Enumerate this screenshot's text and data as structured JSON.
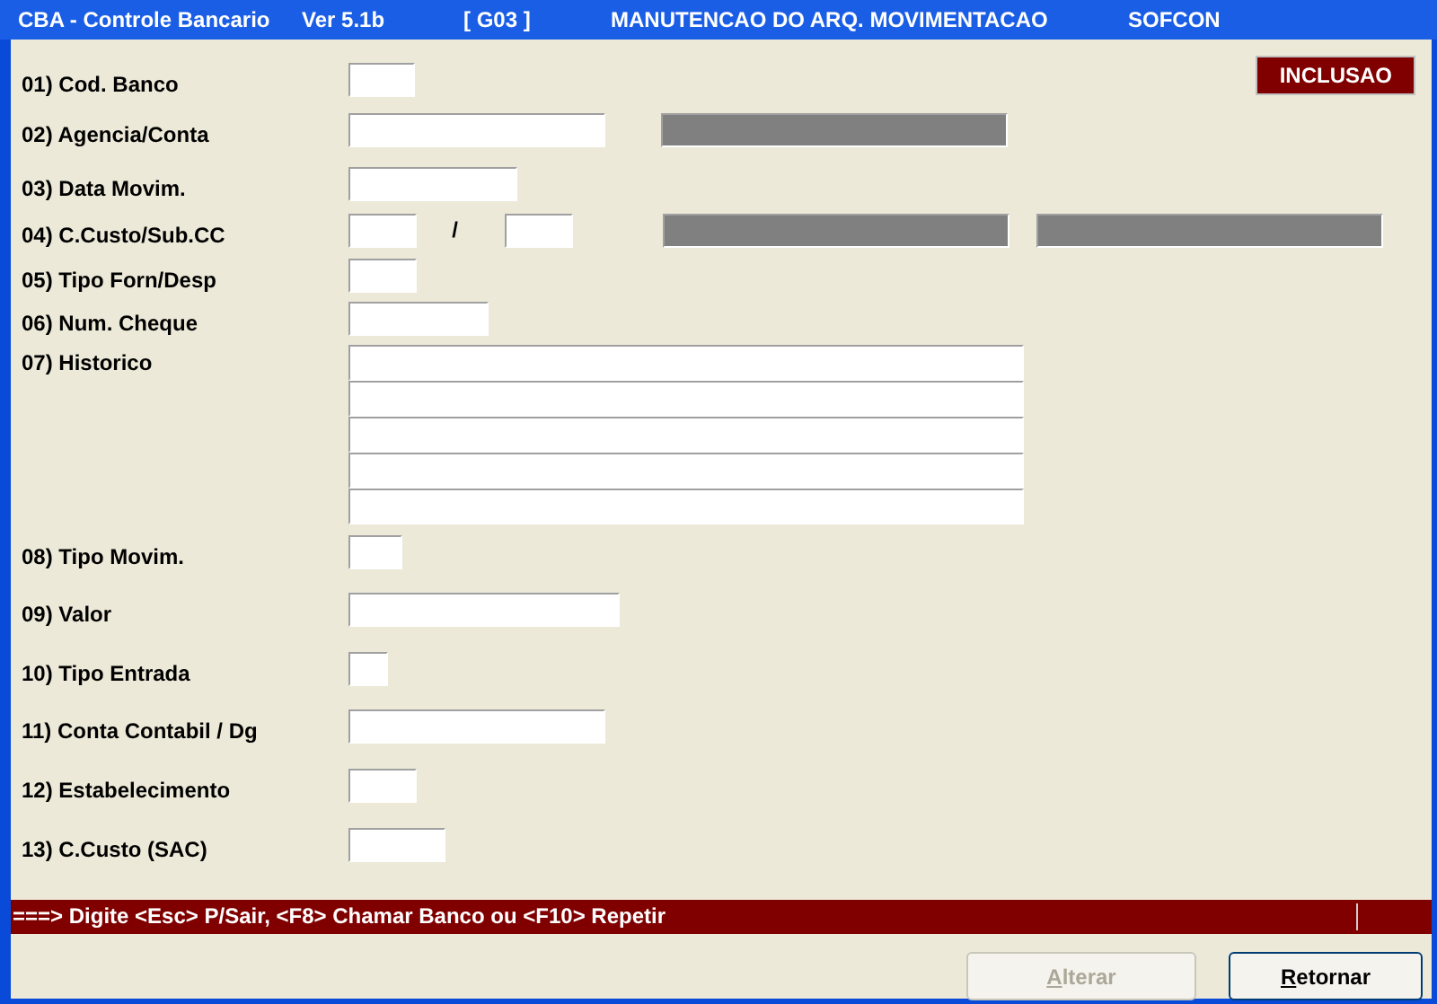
{
  "window": {
    "title_parts": [
      "CBA - Controle Bancario",
      "Ver 5.1b",
      "[ G03 ]",
      "MANUTENCAO DO ARQ. MOVIMENTACAO",
      "SOFCON"
    ]
  },
  "mode_badge": "INCLUSAO",
  "fields": [
    {
      "label": "01)  Cod. Banco",
      "inputs": [
        {
          "kind": "input"
        }
      ]
    },
    {
      "label": "02)  Agencia/Conta",
      "inputs": [
        {
          "kind": "input"
        },
        {
          "kind": "readonly"
        }
      ]
    },
    {
      "label": "03)  Data Movim.",
      "inputs": [
        {
          "kind": "input"
        }
      ]
    },
    {
      "label": "04)  C.Custo/Sub.CC",
      "inputs": [
        {
          "kind": "input"
        },
        {
          "kind": "separator",
          "text": "/"
        },
        {
          "kind": "input"
        },
        {
          "kind": "readonly"
        },
        {
          "kind": "readonly"
        }
      ]
    },
    {
      "label": "05)  Tipo Forn/Desp",
      "inputs": [
        {
          "kind": "input"
        }
      ]
    },
    {
      "label": "06)  Num. Cheque",
      "inputs": [
        {
          "kind": "input"
        }
      ]
    },
    {
      "label": "07)  Historico",
      "inputs": [
        {
          "kind": "line"
        },
        {
          "kind": "line"
        },
        {
          "kind": "line"
        },
        {
          "kind": "line"
        },
        {
          "kind": "line"
        }
      ]
    },
    {
      "label": "08)  Tipo Movim.",
      "inputs": [
        {
          "kind": "input"
        }
      ]
    },
    {
      "label": "09)  Valor",
      "inputs": [
        {
          "kind": "input"
        }
      ]
    },
    {
      "label": "10)  Tipo Entrada",
      "inputs": [
        {
          "kind": "input"
        }
      ]
    },
    {
      "label": "11)  Conta Contabil / Dg",
      "inputs": [
        {
          "kind": "input"
        }
      ]
    },
    {
      "label": "12)  Estabelecimento",
      "inputs": [
        {
          "kind": "input"
        }
      ]
    },
    {
      "label": "13)  C.Custo (SAC)",
      "inputs": [
        {
          "kind": "input"
        }
      ]
    }
  ],
  "status_bar": "===> Digite <Esc> P/Sair, <F8> Chamar Banco ou <F10> Repetir",
  "buttons": [
    {
      "label": "Alterar",
      "disabled": true
    },
    {
      "label": "Retornar",
      "disabled": false
    }
  ]
}
